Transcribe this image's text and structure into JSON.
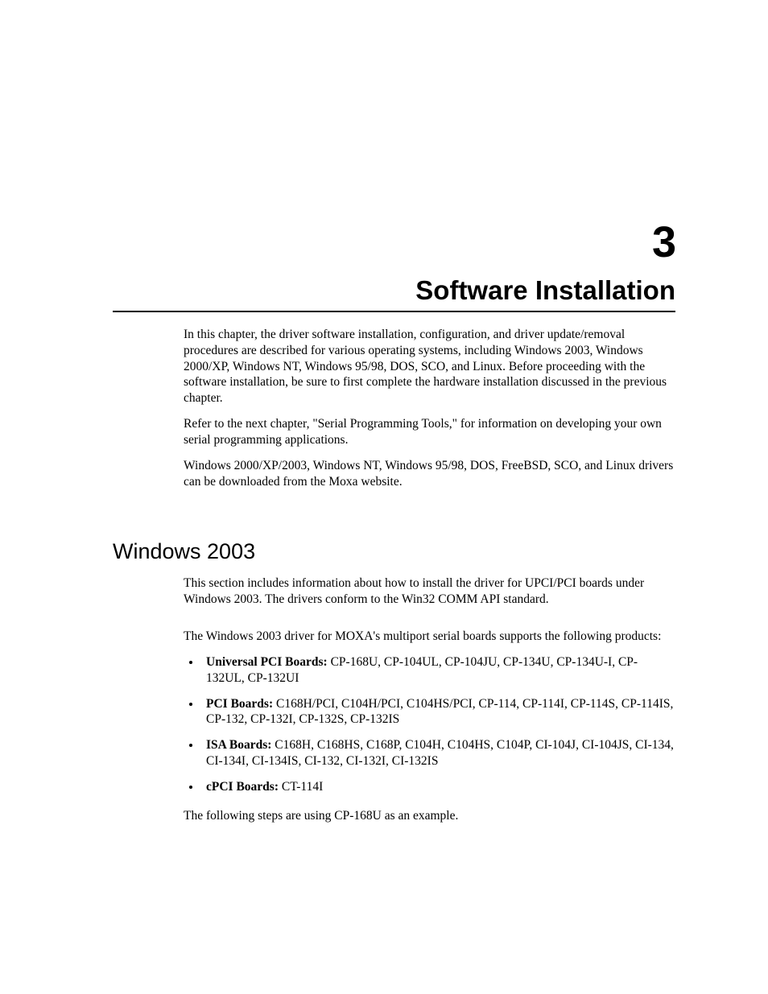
{
  "chapter": {
    "number": "3",
    "title": "Software Installation"
  },
  "intro": {
    "p1": "In this chapter, the driver software installation, configuration, and driver update/removal procedures are described for various operating systems, including Windows 2003, Windows 2000/XP, Windows NT, Windows 95/98, DOS, SCO, and Linux. Before proceeding with the software installation, be sure to first complete the hardware installation discussed in the previous chapter.",
    "p2": "Refer to the next chapter, \"Serial Programming Tools,\" for information on developing your own serial programming applications.",
    "p3": "Windows 2000/XP/2003, Windows NT, Windows 95/98, DOS, FreeBSD, SCO, and Linux drivers can be downloaded from the Moxa website."
  },
  "section": {
    "heading": "Windows 2003",
    "p1": "This section includes information about how to install the driver for UPCI/PCI boards under Windows 2003. The drivers conform to the Win32 COMM API standard.",
    "p2": "The Windows 2003 driver for MOXA's multiport serial boards supports the following products:",
    "bullets": [
      {
        "label": "Universal PCI Boards:",
        "text": " CP-168U, CP-104UL, CP-104JU, CP-134U, CP-134U-I, CP-132UL, CP-132UI"
      },
      {
        "label": "PCI Boards:",
        "text": " C168H/PCI, C104H/PCI, C104HS/PCI, CP-114, CP-114I, CP-114S, CP-114IS, CP-132, CP-132I, CP-132S, CP-132IS"
      },
      {
        "label": "ISA Boards:",
        "text": " C168H, C168HS, C168P, C104H, C104HS, C104P, CI-104J, CI-104JS, CI-134, CI-134I, CI-134IS, CI-132, CI-132I, CI-132IS"
      },
      {
        "label": "cPCI Boards:",
        "text": " CT-114I"
      }
    ],
    "p3": "The following steps are using CP-168U as an example."
  }
}
